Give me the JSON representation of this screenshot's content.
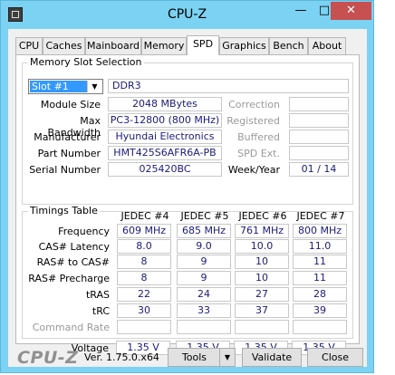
{
  "window": {
    "title": "CPU-Z",
    "minimize": "—",
    "maximize": "□",
    "close": "✕"
  },
  "tabs": [
    "CPU",
    "Caches",
    "Mainboard",
    "Memory",
    "SPD",
    "Graphics",
    "Bench",
    "About"
  ],
  "active_tab": "SPD",
  "slot_section": {
    "title": "Memory Slot Selection",
    "slot_selected": "Slot #1",
    "memory_type": "DDR3",
    "module_size_label": "Module Size",
    "module_size": "2048 MBytes",
    "max_bandwidth_label": "Max Bandwidth",
    "max_bandwidth": "PC3-12800 (800 MHz)",
    "manufacturer_label": "Manufacturer",
    "manufacturer": "Hyundai Electronics",
    "part_number_label": "Part Number",
    "part_number": "HMT425S6AFR6A-PB",
    "serial_number_label": "Serial Number",
    "serial_number": "025420BC",
    "correction_label": "Correction",
    "correction": "",
    "registered_label": "Registered",
    "registered": "",
    "buffered_label": "Buffered",
    "buffered": "",
    "spd_ext_label": "SPD Ext.",
    "spd_ext": "",
    "week_year_label": "Week/Year",
    "week_year": "01 / 14"
  },
  "timings": {
    "title": "Timings Table",
    "columns": [
      "JEDEC #4",
      "JEDEC #5",
      "JEDEC #6",
      "JEDEC #7"
    ],
    "rows": [
      {
        "label": "Frequency",
        "values": [
          "609 MHz",
          "685 MHz",
          "761 MHz",
          "800 MHz"
        ]
      },
      {
        "label": "CAS# Latency",
        "values": [
          "8.0",
          "9.0",
          "10.0",
          "11.0"
        ]
      },
      {
        "label": "RAS# to CAS#",
        "values": [
          "8",
          "9",
          "10",
          "11"
        ]
      },
      {
        "label": "RAS# Precharge",
        "values": [
          "8",
          "9",
          "10",
          "11"
        ]
      },
      {
        "label": "tRAS",
        "values": [
          "22",
          "24",
          "27",
          "28"
        ]
      },
      {
        "label": "tRC",
        "values": [
          "30",
          "33",
          "37",
          "39"
        ]
      },
      {
        "label": "Command Rate",
        "values": [
          "",
          "",
          "",
          ""
        ]
      },
      {
        "label": "Voltage",
        "values": [
          "1.35 V",
          "1.35 V",
          "1.35 V",
          "1.35 V"
        ]
      }
    ]
  },
  "footer": {
    "logo": "CPU-Z",
    "version": "Ver. 1.75.0.x64",
    "tools_label": "Tools",
    "validate_label": "Validate",
    "close_label": "Close"
  }
}
